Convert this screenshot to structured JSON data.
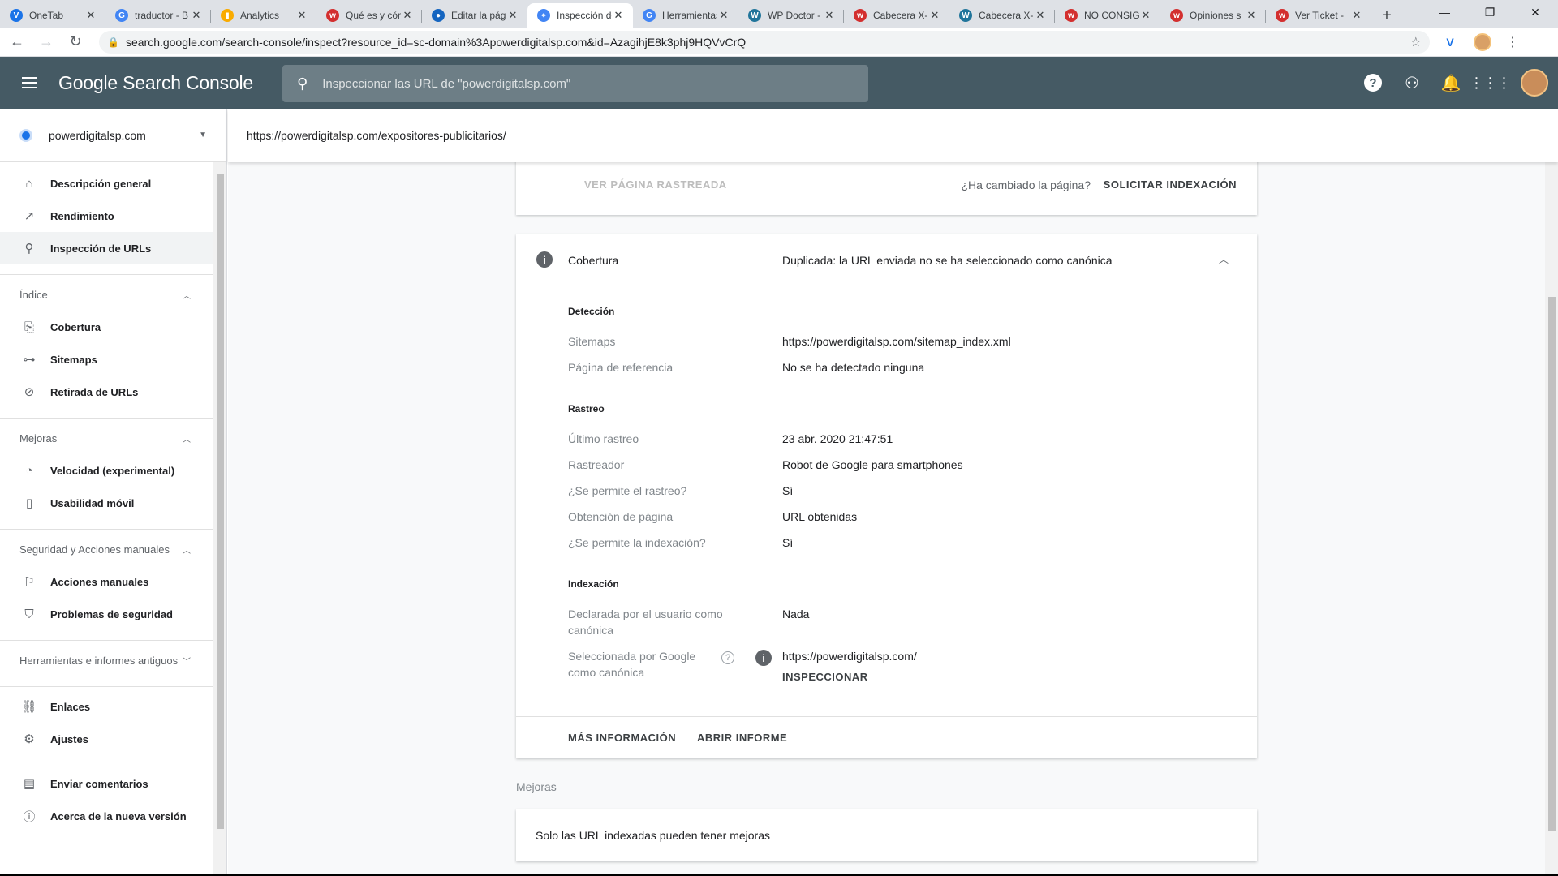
{
  "browser": {
    "tabs": [
      {
        "title": "OneTab",
        "icon": "onetab-icon",
        "color": "#1a73e8",
        "glyph": "V",
        "active": false
      },
      {
        "title": "traductor - B",
        "icon": "google-icon",
        "color": "#4285f4",
        "glyph": "G",
        "active": false
      },
      {
        "title": "Analytics",
        "icon": "analytics-icon",
        "color": "#f9ab00",
        "glyph": "▮",
        "active": false
      },
      {
        "title": "Qué es y cómo",
        "icon": "wp-red-icon",
        "color": "#d32f2f",
        "glyph": "w",
        "active": false
      },
      {
        "title": "Editar la pági",
        "icon": "site-blue-icon",
        "color": "#1565c0",
        "glyph": "●",
        "active": false
      },
      {
        "title": "Inspección de",
        "icon": "gsc-icon",
        "color": "#4285f4",
        "glyph": "⌖",
        "active": true
      },
      {
        "title": "Herramientas",
        "icon": "google-icon",
        "color": "#4285f4",
        "glyph": "G",
        "active": false
      },
      {
        "title": "WP Doctor -",
        "icon": "wordpress-icon",
        "color": "#21759b",
        "glyph": "W",
        "active": false
      },
      {
        "title": "Cabecera X-",
        "icon": "wp-red-icon",
        "color": "#d32f2f",
        "glyph": "w",
        "active": false
      },
      {
        "title": "Cabecera X-",
        "icon": "wordpress-icon",
        "color": "#21759b",
        "glyph": "W",
        "active": false
      },
      {
        "title": "NO CONSIGUE",
        "icon": "wp-red-icon",
        "color": "#d32f2f",
        "glyph": "w",
        "active": false
      },
      {
        "title": "Opiniones s",
        "icon": "wp-red-icon",
        "color": "#d32f2f",
        "glyph": "w",
        "active": false
      },
      {
        "title": "Ver Ticket -",
        "icon": "ticket-icon",
        "color": "#d32f2f",
        "glyph": "w",
        "active": false
      }
    ],
    "url": "search.google.com/search-console/inspect?resource_id=sc-domain%3Apowerdigitalsp.com&id=AzagihjE8k3phj9HQVvCrQ"
  },
  "header": {
    "brand": "Google Search Console",
    "search_placeholder": "Inspeccionar las URL de \"powerdigitalsp.com\""
  },
  "sidebar": {
    "property": "powerdigitalsp.com",
    "top_items": [
      {
        "label": "Descripción general",
        "icon": "home-icon"
      },
      {
        "label": "Rendimiento",
        "icon": "trending-up-icon"
      },
      {
        "label": "Inspección de URLs",
        "icon": "search-icon",
        "active": true
      }
    ],
    "sections": [
      {
        "title": "Índice",
        "expanded": true,
        "items": [
          {
            "label": "Cobertura",
            "icon": "file-copy-icon"
          },
          {
            "label": "Sitemaps",
            "icon": "sitemap-icon"
          },
          {
            "label": "Retirada de URLs",
            "icon": "visibility-off-icon"
          }
        ]
      },
      {
        "title": "Mejoras",
        "expanded": true,
        "items": [
          {
            "label": "Velocidad (experimental)",
            "icon": "speed-icon"
          },
          {
            "label": "Usabilidad móvil",
            "icon": "smartphone-icon"
          }
        ]
      },
      {
        "title": "Seguridad y Acciones manuales",
        "expanded": true,
        "items": [
          {
            "label": "Acciones manuales",
            "icon": "flag-icon"
          },
          {
            "label": "Problemas de seguridad",
            "icon": "shield-icon"
          }
        ]
      },
      {
        "title": "Herramientas e informes antiguos",
        "expanded": false,
        "items": []
      }
    ],
    "bottom_items": [
      {
        "label": "Enlaces",
        "icon": "links-icon"
      },
      {
        "label": "Ajustes",
        "icon": "settings-icon"
      }
    ],
    "footer_items": [
      {
        "label": "Enviar comentarios",
        "icon": "feedback-icon"
      },
      {
        "label": "Acerca de la nueva versión",
        "icon": "info-outline-icon"
      }
    ]
  },
  "inspected_url": "https://powerdigitalsp.com/expositores-publicitarios/",
  "top_card": {
    "view_crawled": "VER PÁGINA RASTREADA",
    "changed_question": "¿Ha cambiado la página?",
    "request_indexing": "SOLICITAR INDEXACIÓN"
  },
  "coverage": {
    "label": "Cobertura",
    "status": "Duplicada: la URL enviada no se ha seleccionado como canónica",
    "detection": {
      "title": "Detección",
      "rows": [
        {
          "label": "Sitemaps",
          "value": "https://powerdigitalsp.com/sitemap_index.xml"
        },
        {
          "label": "Página de referencia",
          "value": "No se ha detectado ninguna"
        }
      ]
    },
    "crawl": {
      "title": "Rastreo",
      "rows": [
        {
          "label": "Último rastreo",
          "value": "23 abr. 2020 21:47:51"
        },
        {
          "label": "Rastreador",
          "value": "Robot de Google para smartphones"
        },
        {
          "label": "¿Se permite el rastreo?",
          "value": "Sí"
        },
        {
          "label": "Obtención de página",
          "value": "URL obtenidas"
        },
        {
          "label": "¿Se permite la indexación?",
          "value": "Sí"
        }
      ]
    },
    "indexing": {
      "title": "Indexación",
      "user_canonical_label": "Declarada por el usuario como canónica",
      "user_canonical_value": "Nada",
      "google_canonical_label": "Seleccionada por Google como canónica",
      "google_canonical_value": "https://powerdigitalsp.com/",
      "inspect_link": "INSPECCIONAR"
    },
    "footer": {
      "more_info": "MÁS INFORMACIÓN",
      "open_report": "ABRIR INFORME"
    }
  },
  "enhancements": {
    "heading": "Mejoras",
    "message": "Solo las URL indexadas pueden tener mejoras"
  }
}
